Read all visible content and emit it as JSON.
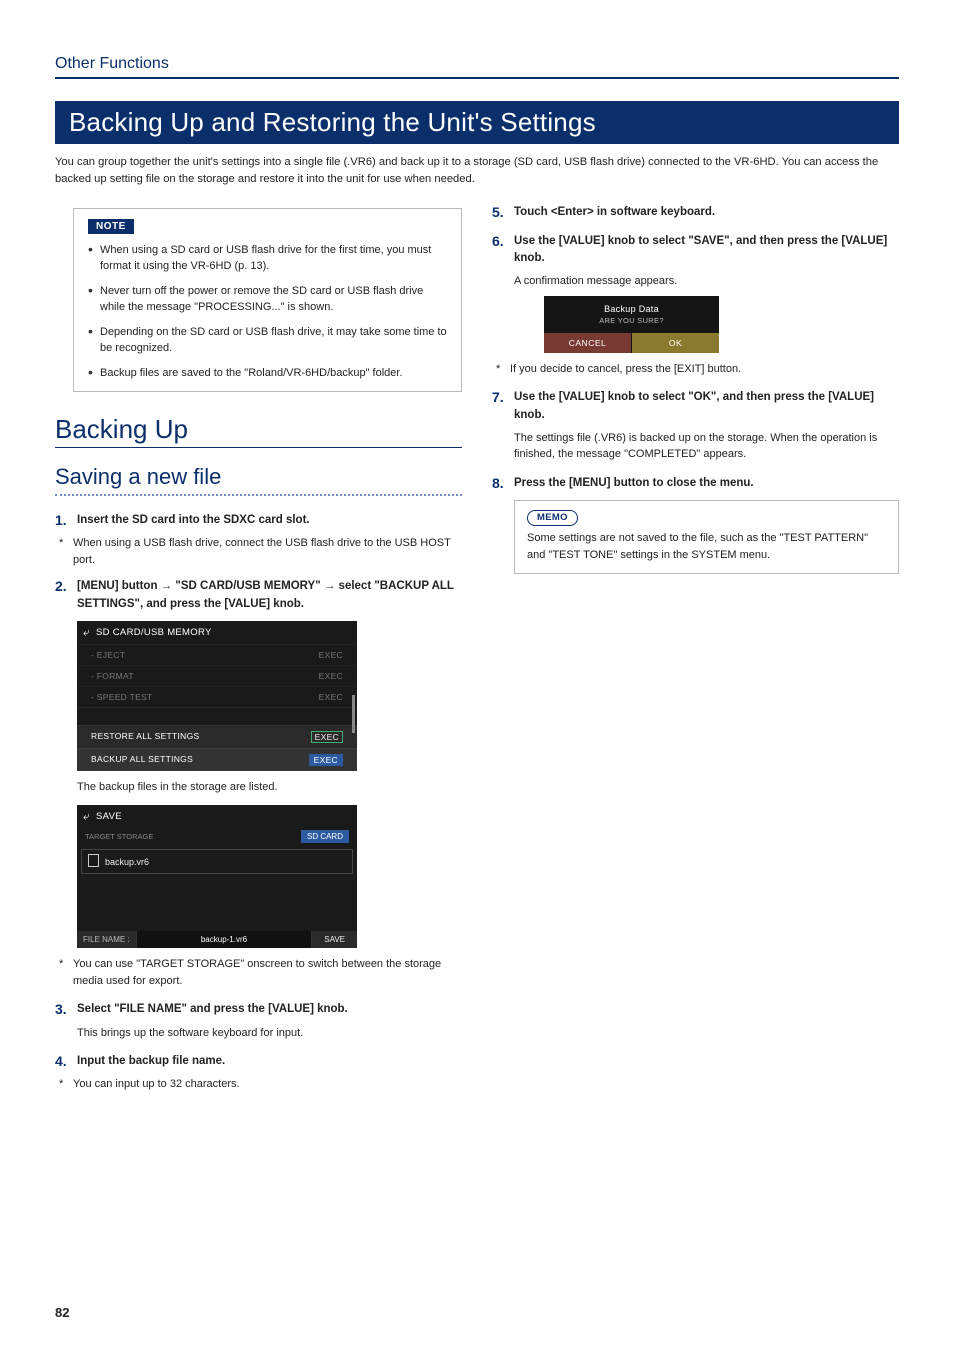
{
  "breadcrumb": "Other Functions",
  "h1": "Backing Up and Restoring the Unit's Settings",
  "intro": "You can group together the unit's settings into a single file (.VR6) and back up it to a storage (SD card, USB flash drive) connected to the VR-6HD. You can access the backed up setting file on the storage and restore it into the unit for use when needed.",
  "note": {
    "label": "NOTE",
    "items": [
      "When using a SD card or USB flash drive for the first time, you must format it using the VR-6HD (p. 13).",
      "Never turn off the power or remove the SD card or USB flash drive while the message \"PROCESSING...\" is shown.",
      "Depending on the SD card or USB flash drive, it may take some time to be recognized.",
      "Backup files are saved to the \"Roland/VR-6HD/backup\" folder."
    ]
  },
  "h2": "Backing Up",
  "h3": "Saving a new file",
  "steps_left": {
    "s1_title": "Insert the SD card into the SDXC card slot.",
    "s1_note": "When using a USB flash drive, connect the USB flash drive to the USB HOST port.",
    "s2_a": "[MENU] button ",
    "s2_b": " \"SD CARD/USB MEMORY\" ",
    "s2_c": " select \"BACKUP ALL SETTINGS\", and press the [VALUE] knob.",
    "ss1": {
      "title": "SD CARD/USB MEMORY",
      "rows": [
        {
          "label": "- EJECT",
          "val": "EXEC"
        },
        {
          "label": "- FORMAT",
          "val": "EXEC"
        },
        {
          "label": "- SPEED TEST",
          "val": "EXEC"
        }
      ],
      "row_hl": {
        "label": "RESTORE ALL SETTINGS",
        "val": "EXEC"
      },
      "row_sel": {
        "label": "BACKUP ALL SETTINGS",
        "val": "EXEC"
      }
    },
    "after_ss1": "The backup files in the storage are listed.",
    "ss2": {
      "title": "SAVE",
      "target_label": "TARGET STORAGE",
      "target_val": "SD CARD",
      "file": "backup.vr6",
      "fn_label": "FILE NAME :",
      "fn_val": "backup-1.vr6",
      "save": "SAVE"
    },
    "after_ss2": "You can use \"TARGET STORAGE\" onscreen to switch between the storage media used for export.",
    "s3_title": "Select \"FILE NAME\" and press the [VALUE] knob.",
    "s3_body": "This brings up the software keyboard for input.",
    "s4_title": "Input the backup file name.",
    "s4_note": "You can input up to 32 characters."
  },
  "steps_right": {
    "s5_title": "Touch <Enter> in software keyboard.",
    "s6_title": "Use the [VALUE] knob to select \"SAVE\", and then press the [VALUE] knob.",
    "s6_body": "A confirmation message appears.",
    "dialog": {
      "title": "Backup Data",
      "sub": "ARE YOU SURE?",
      "cancel": "CANCEL",
      "ok": "OK"
    },
    "s6_note": "If you decide to cancel, press the [EXIT] button.",
    "s7_title": "Use the [VALUE] knob to select \"OK\", and then press the [VALUE] knob.",
    "s7_body": "The settings file (.VR6) is backed up on the storage. When the operation is finished, the message \"COMPLETED\" appears.",
    "s8_title": "Press the [MENU] button to close the menu.",
    "memo": {
      "label": "MEMO",
      "body": "Some settings are not saved to the file, such as the \"TEST PATTERN\" and \"TEST TONE\" settings in the SYSTEM menu."
    }
  },
  "page_number": "82"
}
